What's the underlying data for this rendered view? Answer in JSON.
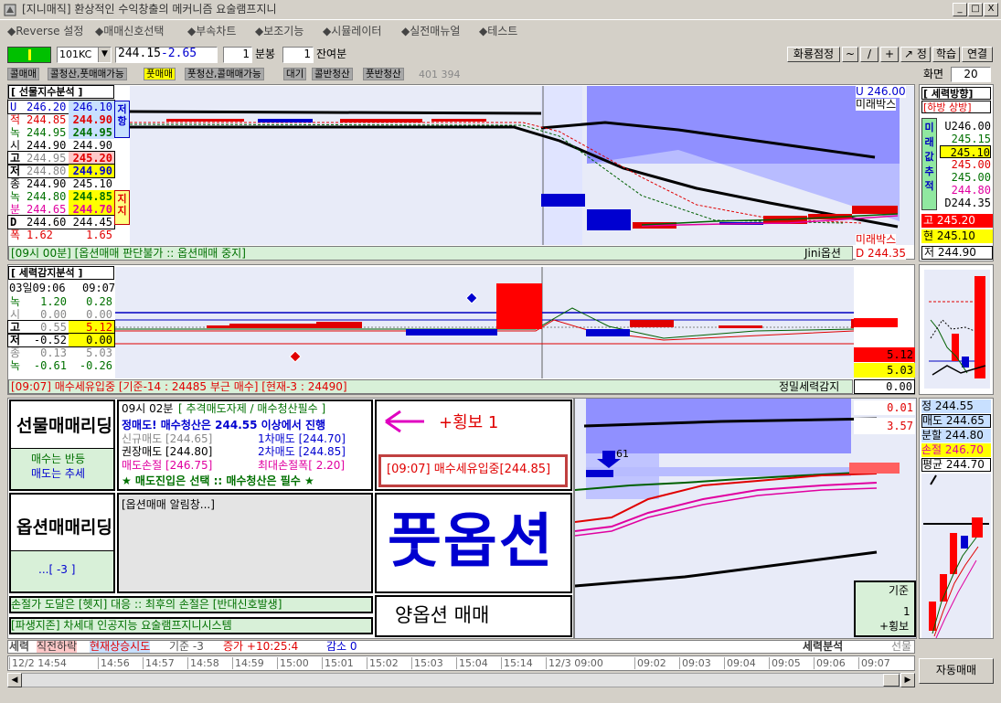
{
  "window": {
    "title": "[지니매직] 환상적인 수익창출의 메커니즘 요술램프지니",
    "btn_min": "_",
    "btn_max": "□",
    "btn_close": "X"
  },
  "menu": [
    "◆Reverse 설정",
    "◆매매신호선택",
    "◆부속차트",
    "◆보조기능",
    "◆시뮬레이터",
    "◆실전매뉴얼",
    "◆테스트"
  ],
  "toolbar": {
    "symbol": "101KC",
    "price": "244.15",
    "change": "-2.65",
    "period_val": "1",
    "period_unit": "분봉",
    "count_val": "1",
    "count_unit": "잔여분",
    "btn_save": "화룡점정",
    "btn_wave": "~",
    "btn_slash": "/",
    "btn_plus": "+",
    "btn_arrow": "↗ 정",
    "btn_learn": "학습",
    "btn_link": "연결",
    "screen_label": "화면",
    "screen_val": "20"
  },
  "mode_tabs": [
    "콜매매",
    "콜청산,풋매매가능",
    "풋매매",
    "풋청산,콜매매가능",
    "대기",
    "콜반청산",
    "풋반청산"
  ],
  "mode_extra": "401 394",
  "futures": {
    "header": "[ 선물지수분석 ]",
    "rows": [
      {
        "l": "U",
        "a": "246.20",
        "b": "246.10"
      },
      {
        "l": "적",
        "a": "244.85",
        "b": "244.90"
      },
      {
        "l": "녹",
        "a": "244.95",
        "b": "244.95"
      },
      {
        "l": "시",
        "a": "244.90",
        "b": "244.90"
      },
      {
        "l": "고",
        "a": "244.95",
        "b": "245.20"
      },
      {
        "l": "저",
        "a": "244.80",
        "b": "244.90"
      },
      {
        "l": "종",
        "a": "244.90",
        "b": "245.10"
      },
      {
        "l": "녹",
        "a": "244.80",
        "b": "244.85"
      },
      {
        "l": "분",
        "a": "244.65",
        "b": "244.70"
      },
      {
        "l": "D",
        "a": "244.60",
        "b": "244.45"
      },
      {
        "l": "폭",
        "a": "1.62",
        "b": "1.65"
      }
    ],
    "side_top": "저항",
    "side_bot": "지지",
    "chart_u": "U 246.00",
    "chart_box_top": "미래박스",
    "chart_box_bot": "미래박스",
    "status": "[09시 00분] [옵션매매 판단불가 :: 옵션매매 중지]",
    "status_right": "Jini옵션",
    "status_d": "D 244.35"
  },
  "force": {
    "header": "[ 세력방향]",
    "sub": "[하방 상방]",
    "vertical": "미래값추적",
    "rows": [
      "U246.00",
      "245.15",
      "245.10",
      "245.00",
      "245.00",
      "244.80",
      "D244.35"
    ],
    "go": "고 245.20",
    "hyun": "현 245.10",
    "jeo": "저 244.90"
  },
  "power": {
    "header": "[ 세력감지분석 ]",
    "date": "03일09:06",
    "time": "09:07",
    "rows": [
      {
        "l": "녹",
        "a": "1.20",
        "b": "0.28"
      },
      {
        "l": "시",
        "a": "0.00",
        "b": "0.00"
      },
      {
        "l": "고",
        "a": "0.55",
        "b": "5.12"
      },
      {
        "l": "저",
        "a": "-0.52",
        "b": "0.00"
      },
      {
        "l": "종",
        "a": "0.13",
        "b": "5.03"
      },
      {
        "l": "녹",
        "a": "-0.61",
        "b": "-0.26"
      }
    ],
    "v1": "5.12",
    "v2": "5.03",
    "v3": "0.00",
    "status": "[09:07] 매수세유입중 [기준-14 : 24485 부근 매수] [현재-3 : 24490]",
    "status_right": "정밀세력감지"
  },
  "leading": {
    "fut_title": "선물매매리딩",
    "fut_sub1": "매수는 반등",
    "fut_sub2": "매도는 추세",
    "line1_time": "09시 02분",
    "line1_rest": "[ 추격매도자제 / 매수청산필수 ]",
    "line2": "정매도! 매수청산은 244.55 이상에서 진행",
    "new_sell": "신규매도 [244.65]",
    "sell1": "1차매도 [244.70]",
    "rec_sell": "권장매도 [244.80]",
    "sell2": "2차매도 [244.85]",
    "stop": "매도손절 [246.75]",
    "max_stop": "최대손절폭[ 2.20]",
    "footer": "★ 매도진입은 선택  ::  매수청산은 필수 ★",
    "arrow_text": "+횡보 1",
    "signal": "[09:07] 매수세유입중[244.85]",
    "opt_title": "옵션매매리딩",
    "opt_sub": "...[ -3 ]",
    "opt_alert": "[옵션매매 알림창...]",
    "put": "풋옵션",
    "yang": "양옵션 매매",
    "bottom1": "손절가 도달은 [헷지] 대응 :: 최후의 손절은 [반대신호발생]",
    "bottom2": "[파생지존] 차세대 인공지능 요술램프지니시스템",
    "marker": "61",
    "r1": "0.01",
    "r2": "3.57",
    "base_label": "기준",
    "base_val": "1",
    "base_sub": "+횡보"
  },
  "right3": {
    "jeong": "정  244.55",
    "sell": "매도 244.65",
    "split": "분할 244.80",
    "stop": "손절 246.70",
    "avg": "평균 244.70"
  },
  "statusbar": {
    "a": "세력",
    "b": "직전하락",
    "c": "현재상승시도",
    "d": "기준 -3",
    "e": "증가 +10:25:4",
    "f": "감소 0",
    "g": "세력분석",
    "h": "선물"
  },
  "timeline": [
    "12/2 14:54",
    "14:56",
    "14:57",
    "14:58",
    "14:59",
    "15:00",
    "15:01",
    "15:02",
    "15:03",
    "15:04",
    "15:14",
    "12/3 09:00",
    "09:02",
    "09:03",
    "09:04",
    "09:05",
    "09:06",
    "09:07"
  ],
  "auto_btn": "자동매매",
  "colors": {
    "up": "#ff0000",
    "down": "#0000ff",
    "green": "#007000",
    "band": "#8080ff",
    "status_bg": "#d8f0d8"
  }
}
